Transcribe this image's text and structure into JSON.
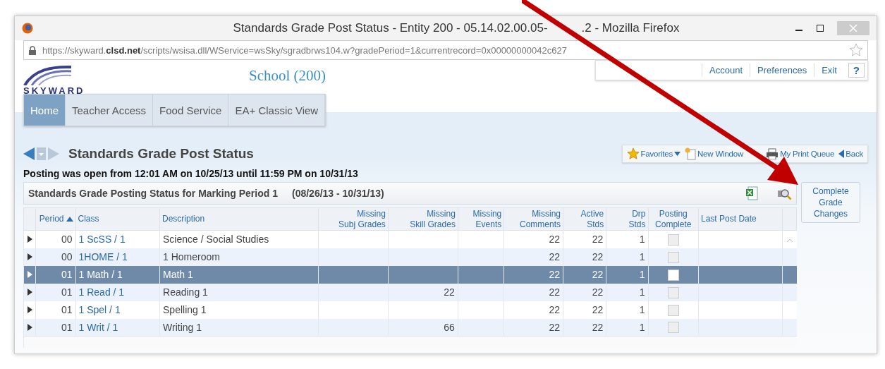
{
  "window": {
    "title_start": "Standards Grade Post Status - Entity 200 - 05.14.02.00.05-",
    "title_end": ".2 - Mozilla Firefox",
    "url_host_pre": "https://skyward.",
    "url_host": "clsd.net",
    "url_path": "/scripts/wsisa.dll/WService=wsSky/sgradbrws104.w?gradePeriod=1&currentrecord=0x00000000042c627"
  },
  "header": {
    "logo": "SKYWARD",
    "school": "School (200)",
    "links": [
      "Account",
      "Preferences",
      "Exit"
    ],
    "help": "?"
  },
  "nav": [
    {
      "label": "Home",
      "selected": true
    },
    {
      "label": "Teacher Access",
      "selected": false
    },
    {
      "label": "Food Service",
      "selected": false
    },
    {
      "label": "EA+ Classic View",
      "selected": false
    }
  ],
  "page": {
    "title": "Standards Grade Post Status",
    "notice": "Posting was open from 12:01 AM on 10/25/13 until 11:59 PM on 10/31/13"
  },
  "toolbar": [
    {
      "kind": "favorites",
      "label": "Favorites"
    },
    {
      "kind": "window",
      "label": "New Window"
    },
    {
      "kind": "print",
      "label": "My Print Queue"
    },
    {
      "kind": "back",
      "label": "Back"
    }
  ],
  "panel": {
    "title": "Standards Grade Posting Status for Marking Period 1",
    "range": "(08/26/13 - 10/31/13)"
  },
  "complete_button": "Complete Grade Changes",
  "table": {
    "columns": [
      {
        "label": "Period",
        "sorted": true
      },
      {
        "label": "Class",
        "sorted": false
      },
      {
        "label": "Description",
        "sorted": false
      },
      {
        "label": "Missing\nSubj Grades",
        "sorted": false
      },
      {
        "label": "Missing\nSkill Grades",
        "sorted": false
      },
      {
        "label": "Missing\nEvents",
        "sorted": false
      },
      {
        "label": "Missing\nComments",
        "sorted": false
      },
      {
        "label": "Active\nStds",
        "sorted": false
      },
      {
        "label": "Drp\nStds",
        "sorted": false
      },
      {
        "label": "Posting\nComplete",
        "sorted": false
      },
      {
        "label": "Last Post Date",
        "sorted": false
      }
    ],
    "rows": [
      {
        "period": "00",
        "class": "1 ScSS / 1",
        "description": "Science / Social Studies",
        "comments": "22",
        "active": "22",
        "drp": "1",
        "posting_complete": false,
        "selected": false
      },
      {
        "period": "00",
        "class": "1HOME / 1",
        "description": "1 Homeroom",
        "comments": "22",
        "active": "22",
        "drp": "1",
        "posting_complete": false,
        "selected": false
      },
      {
        "period": "01",
        "class": "1 Math / 1",
        "description": "Math 1",
        "comments": "22",
        "active": "22",
        "drp": "1",
        "posting_complete": false,
        "selected": true
      },
      {
        "period": "01",
        "class": "1 Read / 1",
        "description": "Reading 1",
        "skill": "22",
        "comments": "22",
        "active": "22",
        "drp": "1",
        "posting_complete": false,
        "selected": false
      },
      {
        "period": "01",
        "class": "1 Spel / 1",
        "description": "Spelling 1",
        "comments": "22",
        "active": "22",
        "drp": "1",
        "posting_complete": false,
        "selected": false
      },
      {
        "period": "01",
        "class": "1 Writ / 1",
        "description": "Writing 1",
        "skill": "66",
        "comments": "22",
        "active": "22",
        "drp": "1",
        "posting_complete": false,
        "selected": false
      }
    ]
  }
}
